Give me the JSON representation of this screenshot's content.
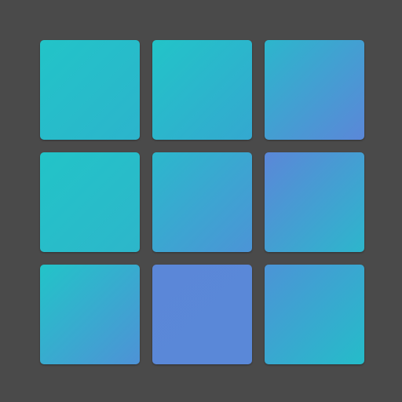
{
  "colors": {
    "background": "#4a4a4a",
    "teal": "#22c4c8",
    "blue": "#5b87d8"
  },
  "tiles": [
    {
      "from": "#22c4c8",
      "to": "#2cb4cc"
    },
    {
      "from": "#22c4c8",
      "to": "#34a8d0"
    },
    {
      "from": "#2cb6cc",
      "to": "#5b87d8"
    },
    {
      "from": "#22c4c8",
      "to": "#2db6ca"
    },
    {
      "from": "#2bb8cc",
      "to": "#4c94d6"
    },
    {
      "from": "#5b87d8",
      "to": "#2db6cc"
    },
    {
      "from": "#22c4c8",
      "to": "#4e92d6"
    },
    {
      "from": "#5b87d8",
      "to": "#5a88d8"
    },
    {
      "from": "#4c94d6",
      "to": "#25bcc9"
    }
  ]
}
